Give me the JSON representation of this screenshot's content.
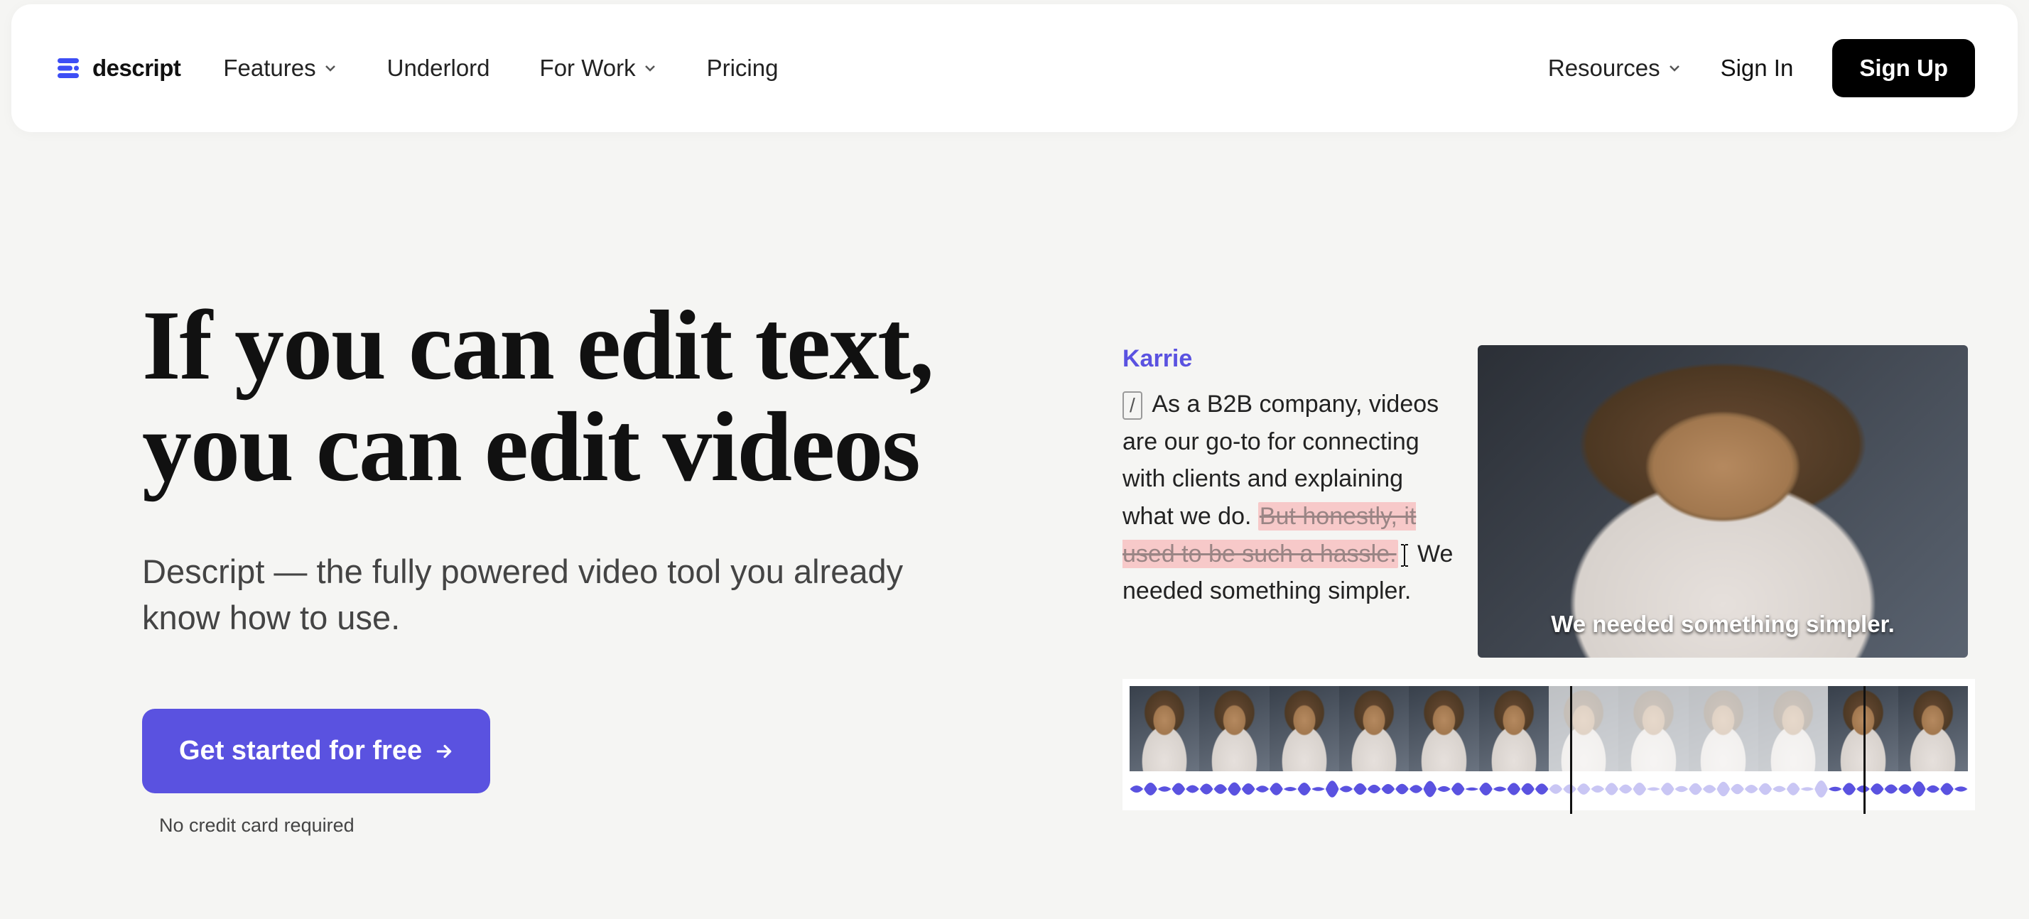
{
  "brand": {
    "name": "descript",
    "accent": "#5a52e0"
  },
  "nav": {
    "items": [
      {
        "label": "Features",
        "hasMenu": true
      },
      {
        "label": "Underlord",
        "hasMenu": false
      },
      {
        "label": "For Work",
        "hasMenu": true
      },
      {
        "label": "Pricing",
        "hasMenu": false
      }
    ],
    "resources_label": "Resources",
    "sign_in_label": "Sign In",
    "sign_up_label": "Sign Up"
  },
  "hero": {
    "headline_l1": "If you can edit text,",
    "headline_l2": "you can edit videos",
    "subhead": "Descript — the fully powered video tool you already know how to use.",
    "cta_label": "Get started for free",
    "disclaimer": "No credit card required"
  },
  "transcript": {
    "speaker": "Karrie",
    "slash": "/",
    "lead": "As a B2B company, videos are our go-to for connecting with clients and explaining what we do. ",
    "struck": "But honestly, it used to be such a hassle.",
    "tail": " We needed something simpler."
  },
  "video": {
    "caption": "We needed something simpler."
  },
  "timeline": {
    "thumb_count": 12,
    "faded_start": 6,
    "faded_end": 9,
    "playhead_positions_pct": [
      52.5,
      87.5
    ]
  }
}
